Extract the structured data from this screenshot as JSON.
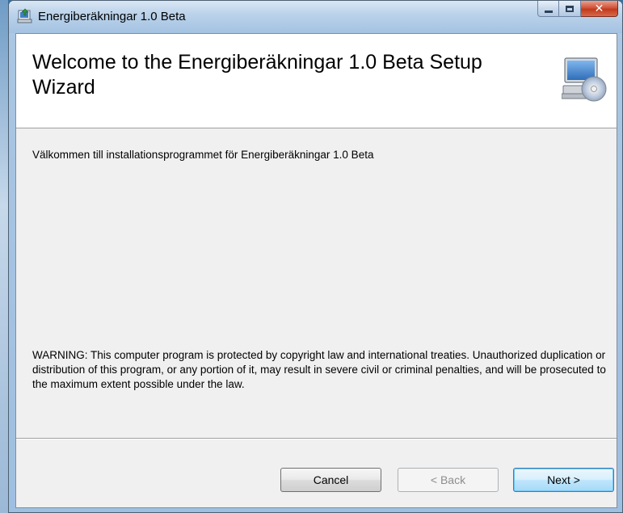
{
  "window": {
    "title": "Energiberäkningar 1.0 Beta"
  },
  "banner": {
    "title": "Welcome to the Energiberäkningar 1.0 Beta Setup Wizard"
  },
  "body": {
    "welcome": "Välkommen till installationsprogrammet för Energiberäkningar 1.0 Beta",
    "warning": "WARNING: This computer program is protected by copyright law and international treaties. Unauthorized duplication or distribution of this program, or any portion of it, may result in severe civil or criminal penalties, and will be prosecuted to the maximum extent possible under the law."
  },
  "buttons": {
    "cancel": "Cancel",
    "back": "< Back",
    "next": "Next >"
  },
  "icons": {
    "app": "installer-icon",
    "banner": "computer-cd-icon"
  },
  "colors": {
    "close_button": "#c13a1d",
    "default_button_border": "#3c7fb1"
  }
}
